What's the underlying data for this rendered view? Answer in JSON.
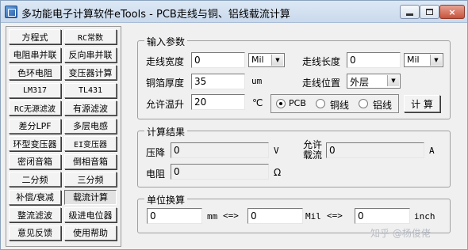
{
  "window": {
    "title": "多功能电子计算软件eTools - PCB走线与铜、铝线载流计算",
    "controls": {
      "minimize": "",
      "maximize": "",
      "close": "×"
    }
  },
  "sidebar": {
    "buttons": [
      "方程式",
      "RC常数",
      "电阻串并联",
      "反向串并联",
      "色环电阻",
      "变压器计算",
      "LM317",
      "TL431",
      "RC无源滤波",
      "有源滤波",
      "差分LPF",
      "多层电感",
      "环型变压器",
      "EI变压器",
      "密闭音箱",
      "倒相音箱",
      "二分频",
      "三分频",
      "补偿/衰减",
      "载流计算",
      "整流滤波",
      "级进电位器",
      "意见反馈",
      "使用帮助"
    ],
    "active": "载流计算"
  },
  "inputs": {
    "group_title": "输入参数",
    "trace_width": {
      "label": "走线宽度",
      "value": "0",
      "unit": "Mil"
    },
    "trace_length": {
      "label": "走线长度",
      "value": "0",
      "unit": "Mil"
    },
    "copper_thickness": {
      "label": "铜箔厚度",
      "value": "35",
      "unit": "um"
    },
    "trace_position": {
      "label": "走线位置",
      "value": "外层"
    },
    "temp_rise": {
      "label": "允许温升",
      "value": "20",
      "unit": "℃"
    },
    "material": {
      "options": [
        "PCB",
        "铜线",
        "铝线"
      ],
      "selected": "PCB"
    },
    "calc_button": "计 算"
  },
  "results": {
    "group_title": "计算结果",
    "voltage_drop": {
      "label": "压降",
      "value": "0",
      "unit": "V"
    },
    "current": {
      "label_line1": "允许",
      "label_line2": "载流",
      "value": "0",
      "unit": "A"
    },
    "resistance": {
      "label": "电阻",
      "value": "0",
      "unit": "Ω"
    }
  },
  "conversion": {
    "group_title": "单位换算",
    "mm": {
      "value": "0",
      "unit": "mm"
    },
    "arrow1": "<=>",
    "mil": {
      "value": "0",
      "unit": "Mil"
    },
    "arrow2": "<=>",
    "inch": {
      "value": "0",
      "unit": "inch"
    }
  },
  "watermark": "知乎 @杨俊佬"
}
